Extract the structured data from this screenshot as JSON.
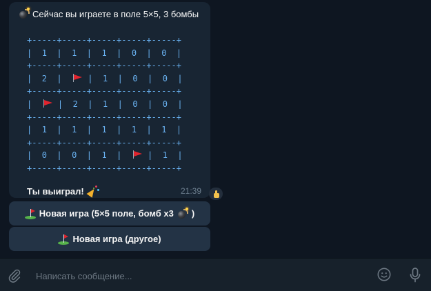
{
  "message": {
    "header_text": "Сейчас вы играете в поле 5×5, 3 бомбы",
    "board": [
      {
        "type": "border",
        "text": "+-----+-----+-----+-----+-----+"
      },
      {
        "type": "row",
        "cells": [
          "1",
          "1",
          "1",
          "0",
          "0"
        ]
      },
      {
        "type": "border",
        "text": "+-----+-----+-----+-----+-----+"
      },
      {
        "type": "row",
        "cells": [
          "2",
          "flag",
          "1",
          "0",
          "0"
        ]
      },
      {
        "type": "border",
        "text": "+-----+-----+-----+-----+-----+"
      },
      {
        "type": "row",
        "cells": [
          "flag",
          "2",
          "1",
          "0",
          "0"
        ]
      },
      {
        "type": "border",
        "text": "+-----+-----+-----+-----+-----+"
      },
      {
        "type": "row",
        "cells": [
          "1",
          "1",
          "1",
          "1",
          "1"
        ]
      },
      {
        "type": "border",
        "text": "+-----+-----+-----+-----+-----+"
      },
      {
        "type": "row",
        "cells": [
          "0",
          "0",
          "1",
          "flag",
          "1"
        ]
      },
      {
        "type": "border",
        "text": "+-----+-----+-----+-----+-----+"
      }
    ],
    "win_text": "Ты выиграл!",
    "time": "21:39",
    "reaction": "thumbs-up-icon"
  },
  "keyboard": {
    "button1_pre": "Новая игра (5×5 поле, бомб x3",
    "button1_post": ")",
    "button2_label": "Новая игра (другое)"
  },
  "composer": {
    "placeholder": "Написать сообщение..."
  },
  "colors": {
    "background": "#0e1621",
    "bubble": "#182533",
    "board_text": "#6ab3f3",
    "button": "#233345",
    "input_bar": "#17212b"
  }
}
